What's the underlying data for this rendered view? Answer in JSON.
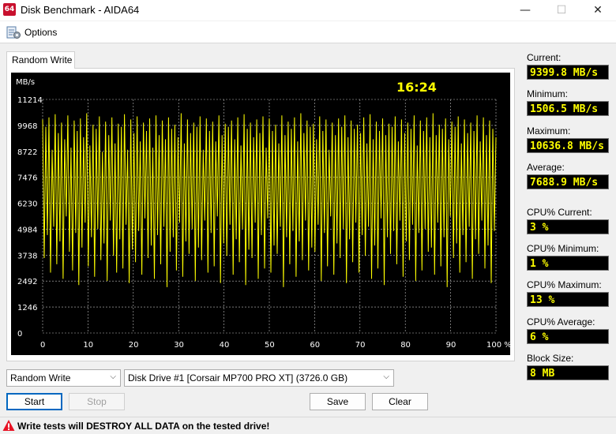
{
  "window": {
    "app_icon_text": "64",
    "title": "Disk Benchmark - AIDA64",
    "minimize_glyph": "—",
    "maximize_glyph": "☐",
    "close_glyph": "✕"
  },
  "menu": {
    "icon": "options-icon",
    "options_label": "Options"
  },
  "tab": {
    "label": "Random Write"
  },
  "chart_data": {
    "type": "line",
    "ylabel": "MB/s",
    "y_ticks": [
      "11214",
      "9968",
      "8722",
      "7476",
      "6230",
      "4984",
      "3738",
      "2492",
      "1246",
      "0"
    ],
    "ylim": [
      0,
      11214
    ],
    "x_ticks": [
      "0",
      "10",
      "20",
      "30",
      "40",
      "50",
      "60",
      "70",
      "80",
      "90",
      "100 %"
    ],
    "xlim": [
      0,
      100
    ],
    "elapsed_time": "16:24",
    "grid": true,
    "line_color": "#ffff00",
    "grid_color": "#c0c0c0",
    "background": "#000000",
    "series": [
      {
        "x_range_percent": [
          0,
          100
        ],
        "values_mbps": [
          10250,
          3600,
          9900,
          4700,
          10350,
          2900,
          8800,
          5100,
          10500,
          3300,
          9600,
          4400,
          10100,
          2600,
          9300,
          5600,
          10450,
          3900,
          8900,
          3000,
          10200,
          4800,
          9700,
          2300,
          10300,
          4100,
          9400,
          5300,
          10550,
          3200,
          9000,
          4600,
          10000,
          2700,
          9800,
          5000,
          10400,
          3500,
          8700,
          4300,
          10150,
          2500,
          9500,
          5400,
          10350,
          3700,
          9100,
          2900,
          10050,
          4500,
          9900,
          3100,
          10500,
          5200,
          8800,
          2400,
          10250,
          4000,
          9600,
          3400,
          10400,
          4900,
          9200,
          2800,
          10100,
          5500,
          9700,
          3600,
          10300,
          4200,
          8900,
          2600,
          10450,
          4700,
          9500,
          3300,
          10200,
          5100,
          9300,
          2200,
          10350,
          3900,
          9800,
          4600,
          10000,
          3000,
          9400,
          5300,
          10550,
          2700,
          9100,
          4400,
          10250,
          3800,
          9600,
          5000,
          10100,
          2500,
          9900,
          4100,
          10400,
          3500,
          8800,
          5400,
          10300,
          2900,
          9700,
          4800,
          10150,
          3200,
          9200,
          5600,
          10450,
          2400,
          9500,
          4300,
          10050,
          3700,
          9900,
          5200,
          10200,
          2800,
          9300,
          4500,
          10350,
          3400,
          9000,
          5000,
          10500,
          2300,
          9800,
          4000,
          10100,
          3600,
          9400,
          5300,
          10250,
          2600,
          9600,
          4700,
          10400,
          3100,
          8900,
          5500,
          10300,
          2900,
          9700,
          4200,
          10000,
          3800,
          9100,
          5100,
          10450,
          2200,
          9500,
          4600,
          10150,
          3300,
          9800,
          4900,
          10350,
          2700,
          9200,
          4400,
          10550,
          3500,
          9600,
          5400,
          10200,
          3000,
          9900,
          4100,
          10050,
          3900,
          9300,
          5200,
          10400,
          2500,
          9700,
          4800,
          10250,
          3200,
          8800,
          5600,
          10100,
          2800,
          9500,
          4300,
          10300,
          3600,
          9900,
          5000,
          10450,
          2400,
          9400,
          4500,
          10200,
          3400,
          9800,
          5300,
          10000,
          2900,
          9600,
          4700,
          10350,
          3700,
          9100,
          5100,
          10500,
          2600,
          9300,
          4200,
          10150,
          3100,
          9700,
          5500,
          10300,
          2300,
          9500,
          4600,
          10050,
          3800,
          9900,
          4900,
          10400,
          3300,
          9200,
          5400,
          10250,
          2700,
          9600,
          4400,
          10100,
          3500,
          9800,
          5200,
          10450,
          2500,
          9000,
          4800,
          10200,
          3000,
          9700,
          5000,
          10350,
          3900,
          9400,
          4100,
          10550,
          2800,
          9500,
          5300,
          10000,
          3200,
          9800,
          4600,
          10300,
          2200,
          9300,
          5600,
          10150,
          3600,
          9900,
          4300,
          10400,
          2900,
          9100,
          4700,
          10250,
          3400,
          9600,
          5100,
          10100,
          2600,
          9700,
          4500,
          10450,
          3800,
          9200,
          5400,
          10350,
          3100,
          9500,
          4200,
          10200,
          2400,
          9800,
          4900,
          9400
        ]
      }
    ]
  },
  "stats": {
    "current_label": "Current:",
    "current_value": "9399.8 MB/s",
    "minimum_label": "Minimum:",
    "minimum_value": "1506.5 MB/s",
    "maximum_label": "Maximum:",
    "maximum_value": "10636.8 MB/s",
    "average_label": "Average:",
    "average_value": "7688.9 MB/s",
    "cpu_current_label": "CPU% Current:",
    "cpu_current_value": "3 %",
    "cpu_minimum_label": "CPU% Minimum:",
    "cpu_minimum_value": "1 %",
    "cpu_maximum_label": "CPU% Maximum:",
    "cpu_maximum_value": "13 %",
    "cpu_average_label": "CPU% Average:",
    "cpu_average_value": "6 %",
    "block_size_label": "Block Size:",
    "block_size_value": "8 MB"
  },
  "controls": {
    "test_select_value": "Random Write",
    "drive_select_value": "Disk Drive #1  [Corsair MP700 PRO XT]  (3726.0 GB)",
    "dropdown_arrow": "⌵",
    "start_label": "Start",
    "stop_label": "Stop",
    "save_label": "Save",
    "clear_label": "Clear"
  },
  "status": {
    "warning_icon": "warning-icon",
    "warning_text": "Write tests will DESTROY ALL DATA on the tested drive!"
  }
}
